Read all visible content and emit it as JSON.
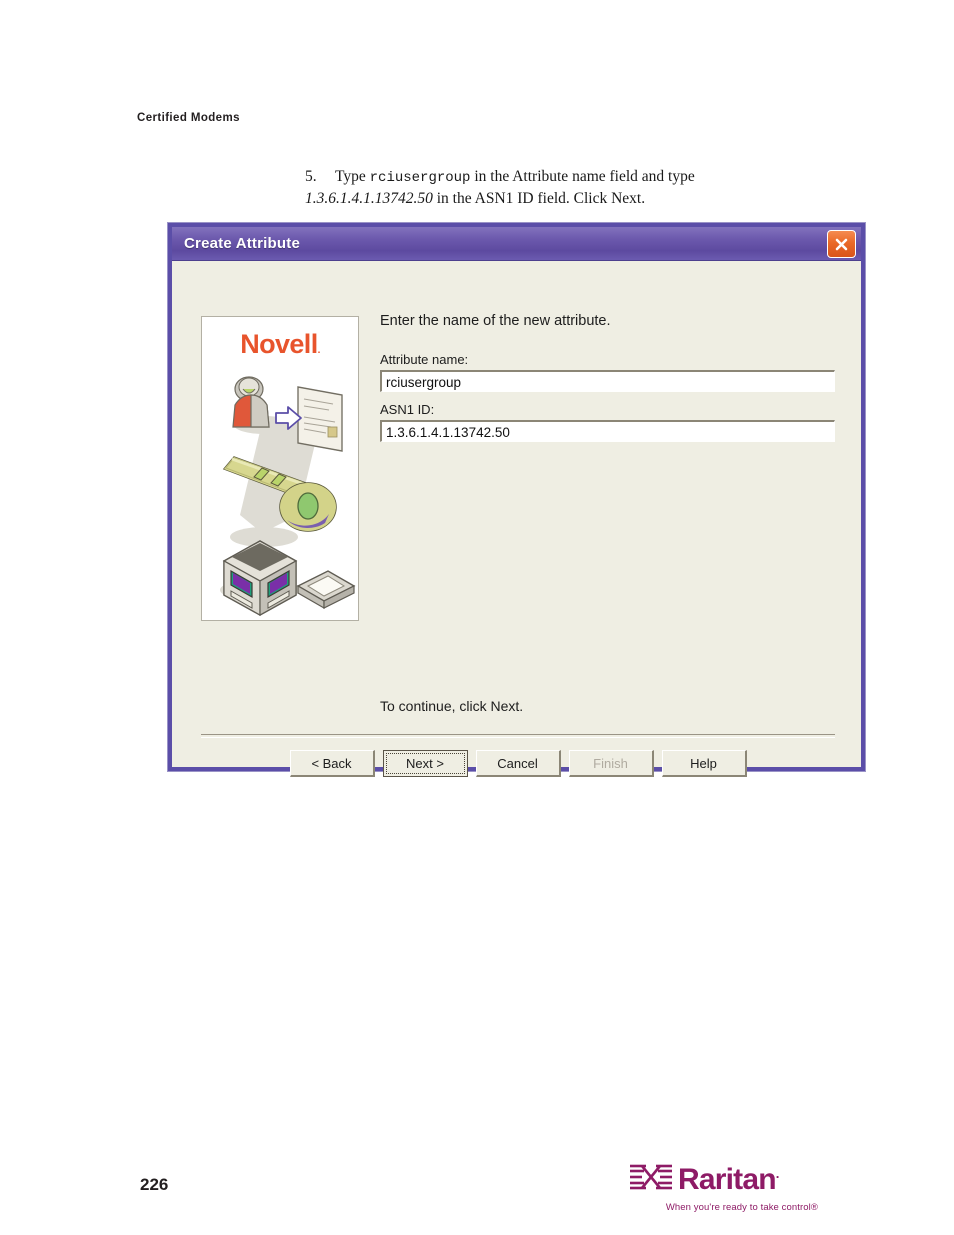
{
  "page": {
    "running_header": "Certified Modems",
    "page_number": "226"
  },
  "step": {
    "number": "5.",
    "text_part1": "Type ",
    "mono_value": "rciusergroup",
    "text_part2": " in the Attribute name field and type ",
    "italic_value": "1.3.6.1.4.1.13742.50",
    "text_part3": " in the ASN1 ID field. Click Next."
  },
  "dialog": {
    "title": "Create Attribute",
    "close_label": "×",
    "brand": {
      "logo_text": "Novell",
      "logo_tm": "."
    },
    "intro": "Enter the name of the new attribute.",
    "fields": [
      {
        "label": "Attribute name:",
        "value": "rciusergroup",
        "placeholder": ""
      },
      {
        "label": "ASN1 ID:",
        "value": "1.3.6.1.4.1.13742.50",
        "placeholder": ""
      }
    ],
    "continue_text": "To continue, click Next.",
    "buttons": [
      {
        "label": "< Back",
        "state": "enabled"
      },
      {
        "label": "Next >",
        "state": "default"
      },
      {
        "label": "Cancel",
        "state": "enabled"
      },
      {
        "label": "Finish",
        "state": "disabled"
      },
      {
        "label": "Help",
        "state": "enabled"
      }
    ]
  },
  "footer": {
    "brand_name": "Raritan",
    "brand_reg": ".",
    "tagline": "When you're ready to take control®"
  },
  "colors": {
    "titlebar_purple": "#5d4aa0",
    "dialog_border": "#5b4ea8",
    "dialog_face": "#efeee3",
    "close_orange": "#ea6a28",
    "novell_orange": "#e8542c",
    "raritan_magenta": "#8e1b66",
    "field_white": "#ffffff"
  }
}
